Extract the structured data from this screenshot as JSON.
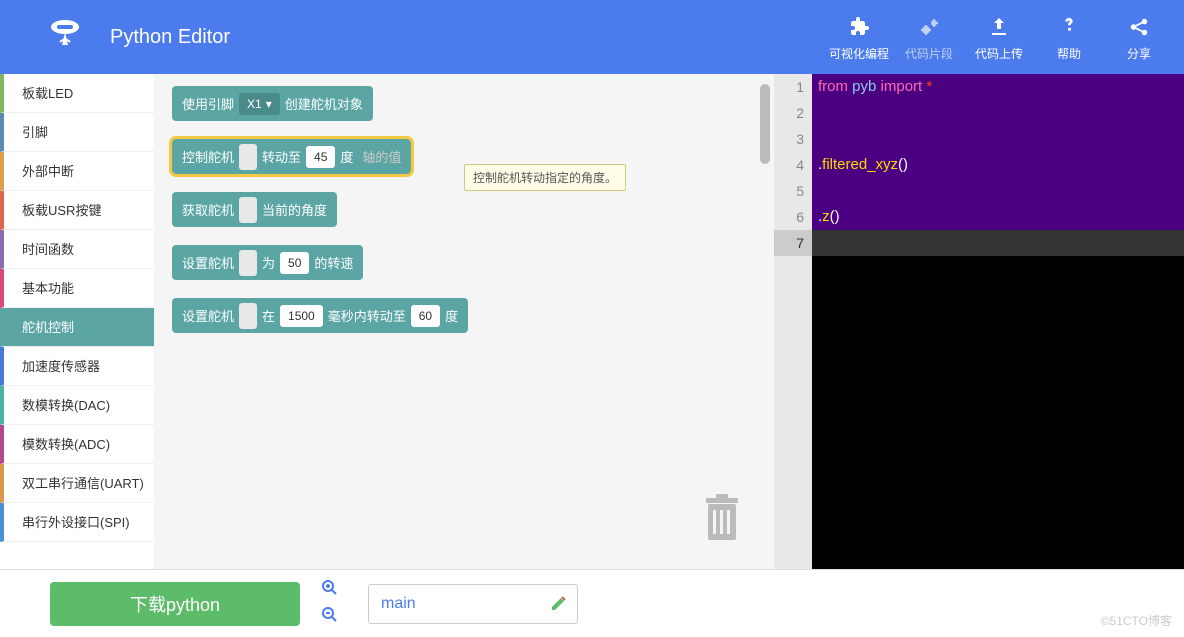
{
  "header": {
    "app_title": "Python Editor",
    "menu": {
      "visual": "可视化编程",
      "snippet": "代码片段",
      "upload": "代码上传",
      "help": "帮助",
      "share": "分享"
    }
  },
  "sidebar": {
    "items": [
      {
        "label": "板载LED"
      },
      {
        "label": "引脚"
      },
      {
        "label": "外部中断"
      },
      {
        "label": "板载USR按键"
      },
      {
        "label": "时间函数"
      },
      {
        "label": "基本功能"
      },
      {
        "label": "舵机控制"
      },
      {
        "label": "加速度传感器"
      },
      {
        "label": "数模转换(DAC)"
      },
      {
        "label": "模数转换(ADC)"
      },
      {
        "label": "双工串行通信(UART)"
      },
      {
        "label": "串行外设接口(SPI)"
      }
    ]
  },
  "blocks": {
    "b1_a": "使用引脚",
    "b1_pin": "X1",
    "b1_b": "创建舵机对象",
    "b2_a": "控制舵机",
    "b2_b": "转动至",
    "b2_val": "45",
    "b2_c": "度",
    "b2_ghost": "轴的值",
    "b3_a": "获取舵机",
    "b3_b": "当前的角度",
    "b4_a": "设置舵机",
    "b4_b": "为",
    "b4_val": "50",
    "b4_c": "的转速",
    "b5_a": "设置舵机",
    "b5_b": "在",
    "b5_ms": "1500",
    "b5_c": "毫秒内转动至",
    "b5_deg": "60",
    "b5_d": "度",
    "tooltip": "控制舵机转动指定的角度。"
  },
  "code": {
    "lines": [
      1,
      2,
      3,
      4,
      5,
      6,
      7
    ],
    "l1_kw": "from ",
    "l1_mod": "pyb ",
    "l1_kw2": "import ",
    "l1_op": "*",
    "l4": ".filtered_xyz()",
    "l6": ".z()"
  },
  "footer": {
    "download": "下载python",
    "filename": "main"
  },
  "watermark": "©51CTO博客"
}
